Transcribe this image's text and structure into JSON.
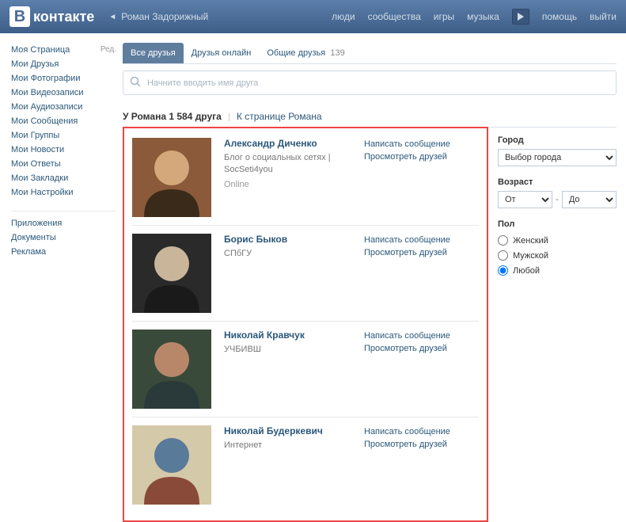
{
  "header": {
    "logo_text": "контакте",
    "logo_letter": "В",
    "profile_name": "Роман Задорижный",
    "nav": {
      "people": "люди",
      "communities": "сообщества",
      "games": "игры",
      "music": "музыка",
      "help": "помощь",
      "logout": "выйти"
    }
  },
  "sidebar": {
    "edit": "Ред.",
    "items": [
      "Моя Страница",
      "Мои Друзья",
      "Мои Фотографии",
      "Мои Видеозаписи",
      "Мои Аудиозаписи",
      "Мои Сообщения",
      "Мои Группы",
      "Мои Новости",
      "Мои Ответы",
      "Мои Закладки",
      "Мои Настройки"
    ],
    "extra": [
      "Приложения",
      "Документы",
      "Реклама"
    ]
  },
  "tabs": {
    "all": "Все друзья",
    "online": "Друзья онлайн",
    "mutual": "Общие друзья",
    "mutual_count": "139"
  },
  "search": {
    "placeholder": "Начните вводить имя друга"
  },
  "summary": {
    "text": "У Романа 1 584 друга",
    "link": "К странице Романа"
  },
  "friends": [
    {
      "name": "Александр Диченко",
      "sub": "Блог о социальных сетях | SocSeti4you",
      "online": "Online",
      "avatar_colors": [
        "#8a5a3a",
        "#d4a87a",
        "#3a2a1a"
      ]
    },
    {
      "name": "Борис Быков",
      "sub": "СПбГУ",
      "online": "",
      "avatar_colors": [
        "#2a2a2a",
        "#c9b59a",
        "#1a1a1a"
      ]
    },
    {
      "name": "Николай Кравчук",
      "sub": "УЧБИВШ",
      "online": "",
      "avatar_colors": [
        "#3a4a3a",
        "#b8876a",
        "#2a3a3a"
      ]
    },
    {
      "name": "Николай Будеркевич",
      "sub": "Интернет",
      "online": "",
      "avatar_colors": [
        "#d4c9a8",
        "#5a7a9a",
        "#8a4a3a"
      ]
    }
  ],
  "friend_actions": {
    "message": "Написать сообщение",
    "view_friends": "Просмотреть друзей"
  },
  "filters": {
    "city_label": "Город",
    "city_value": "Выбор города",
    "age_label": "Возраст",
    "age_from": "От",
    "age_to": "До",
    "gender_label": "Пол",
    "gender_female": "Женский",
    "gender_male": "Мужской",
    "gender_any": "Любой"
  }
}
